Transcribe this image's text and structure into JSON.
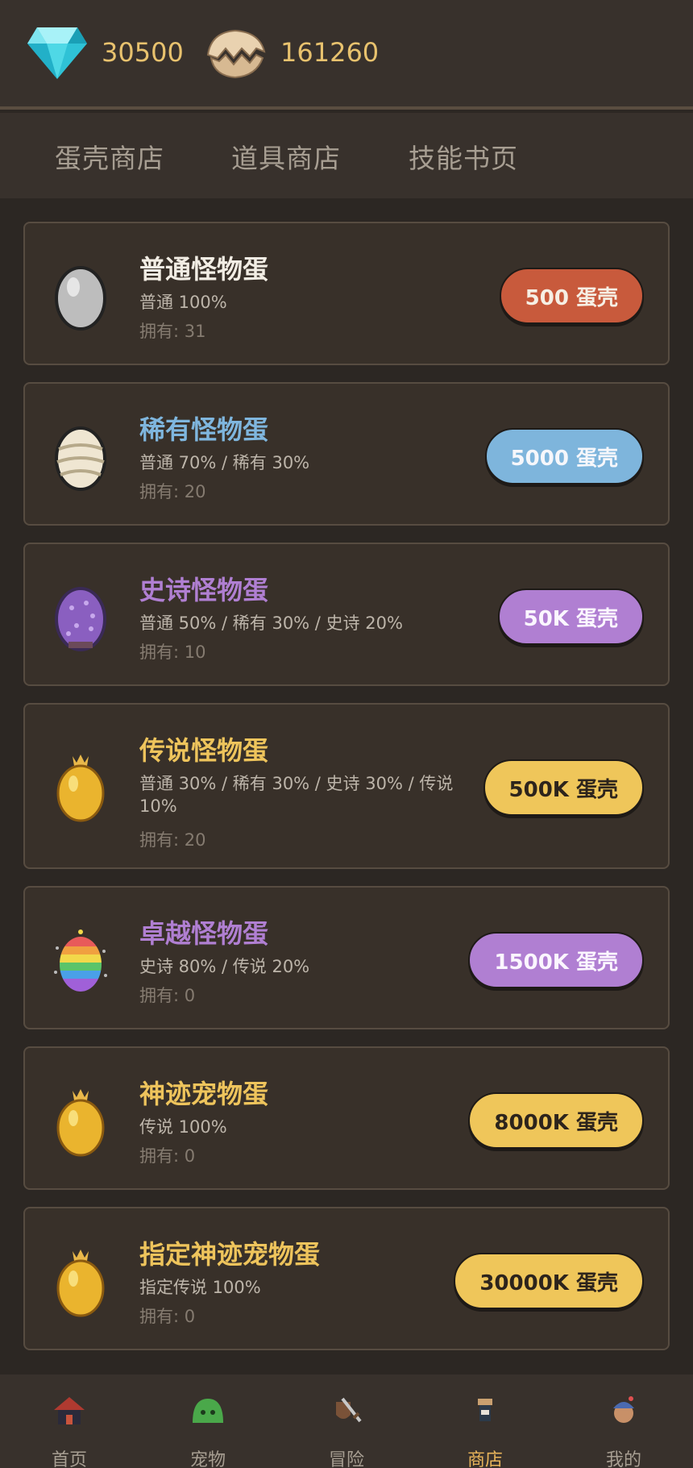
{
  "currency": {
    "diamond": {
      "icon": "diamond-icon",
      "value": "30500"
    },
    "eggshell": {
      "icon": "eggshell-icon",
      "value": "161260"
    }
  },
  "tabs": [
    {
      "label": "蛋壳商店",
      "active": true
    },
    {
      "label": "道具商店",
      "active": false
    },
    {
      "label": "技能书页",
      "active": false
    }
  ],
  "eggs": [
    {
      "name": "普通怪物蛋",
      "odds": "普通 100%",
      "owned": "拥有: 31",
      "price": "500 蛋壳",
      "name_color": "#f2ede4",
      "button_color": "#c85a3c",
      "button_text_color": "#f6efe4",
      "icon": "common-egg-icon"
    },
    {
      "name": "稀有怪物蛋",
      "odds": "普通 70% / 稀有 30%",
      "owned": "拥有: 20",
      "price": "5000 蛋壳",
      "name_color": "#7fb6de",
      "button_color": "#7eb5dc",
      "button_text_color": "#f6f7fb",
      "icon": "rare-egg-icon"
    },
    {
      "name": "史诗怪物蛋",
      "odds": "普通 50% / 稀有 30% / 史诗 20%",
      "owned": "拥有: 10",
      "price": "50K 蛋壳",
      "name_color": "#b07fd2",
      "button_color": "#b07fd2",
      "button_text_color": "#fbf6ff",
      "icon": "epic-egg-icon"
    },
    {
      "name": "传说怪物蛋",
      "odds": "普通 30% / 稀有 30% / 史诗 30% / 传说 10%",
      "owned": "拥有: 20",
      "price": "500K 蛋壳",
      "name_color": "#eec45c",
      "button_color": "#efc65a",
      "button_text_color": "#2d241c",
      "icon": "legendary-egg-icon"
    },
    {
      "name": "卓越怪物蛋",
      "odds": "史诗 80% / 传说 20%",
      "owned": "拥有: 0",
      "price": "1500K 蛋壳",
      "name_color": "#b07fd2",
      "button_color": "#b07fd2",
      "button_text_color": "#fbf6ff",
      "icon": "rainbow-egg-icon"
    },
    {
      "name": "神迹宠物蛋",
      "odds": "传说 100%",
      "owned": "拥有: 0",
      "price": "8000K 蛋壳",
      "name_color": "#eec45c",
      "button_color": "#efc65a",
      "button_text_color": "#2d241c",
      "icon": "golden-egg-icon"
    },
    {
      "name": "指定神迹宠物蛋",
      "odds": "指定传说 100%",
      "owned": "拥有: 0",
      "price": "30000K 蛋壳",
      "name_color": "#eec45c",
      "button_color": "#efc65a",
      "button_text_color": "#2d241c",
      "icon": "golden-egg-icon"
    }
  ],
  "nav": [
    {
      "label": "首页",
      "icon": "home-icon",
      "active": false
    },
    {
      "label": "宠物",
      "icon": "slime-icon",
      "active": false
    },
    {
      "label": "冒险",
      "icon": "sword-shield-icon",
      "active": false
    },
    {
      "label": "商店",
      "icon": "shop-icon",
      "active": true
    },
    {
      "label": "我的",
      "icon": "profile-icon",
      "active": false
    }
  ]
}
